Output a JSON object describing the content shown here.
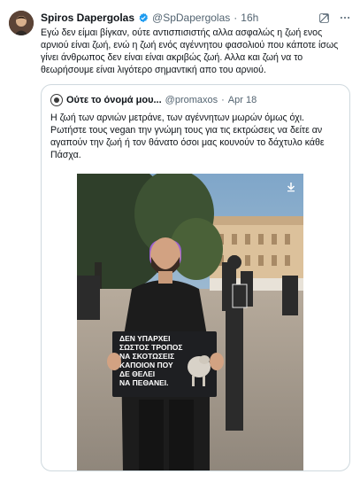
{
  "tweet": {
    "display_name": "Spiros Dapergolas",
    "handle": "@SpDapergolas",
    "dot": "·",
    "time": "16h",
    "text": "Εγώ δεν είμαι βίγκαν, ούτε αντισπισιστής αλλα ασφαλώς η ζωή ενος αρνιού είναι ζωή, ενώ η ζωή ενός αγέννητου φασολιού που κάποτε ίσως γίνει άνθρωπος δεν είναι είναι ακριβώς ζωή. Αλλα και ζωή να το θεωρήσουμε είναι λιγότερο σημαντική απο του αρνιού."
  },
  "quoted_tweet": {
    "display_name": "Ούτε το όνομά μου...",
    "handle": "@promaxos",
    "dot": "·",
    "time": "Apr 18",
    "text": "Η ζωή των αρνιών μετράνε, των αγέννητων μωρών όμως όχι. Ρωτήστε τους vegan την γνώμη τους για τις εκτρώσεις να δείτε αν αγαπούν την ζωή ή τον θάνατο όσοι μας κουνούν το δάχτυλο κάθε Πάσχα."
  },
  "media": {
    "sign_lines": [
      "ΔΕΝ ΥΠΑΡΧΕΙ",
      "ΣΩΣΤΟΣ ΤΡΟΠΟΣ",
      "ΝΑ ΣΚΟΤΩΣΕΙΣ",
      "ΚΑΠΟΙΟΝ ΠΟΥ",
      "ΔΕ ΘΕΛΕΙ",
      "ΝΑ ΠΕΘΑΝΕΙ."
    ]
  },
  "icons": {
    "verified": "verified-badge-icon",
    "grok": "grok-icon",
    "more": "more-options-icon",
    "download": "download-icon"
  },
  "colors": {
    "verified": "#1d9bf0",
    "secondary_text": "#536471",
    "border": "#cfd9de",
    "sign_background": "#1e1f22"
  }
}
